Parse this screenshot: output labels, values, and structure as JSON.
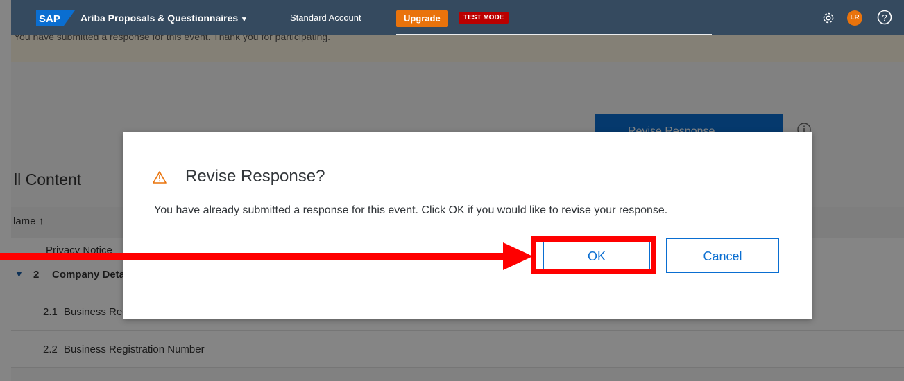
{
  "topbar": {
    "logo": "SAP",
    "product": "Ariba Proposals & Questionnaires",
    "product_caret": "▾",
    "account": "Standard Account",
    "upgrade": "Upgrade",
    "test_mode": "TEST MODE",
    "avatar_initials": "LR"
  },
  "banner": {
    "text": "You have submitted a response for this event.  Thank you for participating."
  },
  "background": {
    "revise_button": "Revise Response",
    "content_title": "ll Content",
    "name_header": "lame ↑",
    "rows": [
      {
        "text": "Privacy Notice"
      },
      {
        "toggle": "▼",
        "num": "2",
        "text": "Company Details"
      },
      {
        "num": "2.1",
        "text": "Business Registration"
      },
      {
        "num": "2.2",
        "text": "Business Registration Number"
      }
    ]
  },
  "dialog": {
    "title": "Revise Response?",
    "message": "You have already submitted a response for this event. Click OK if you would like to revise your response.",
    "ok_label": "OK",
    "cancel_label": "Cancel"
  },
  "colors": {
    "topbar": "#354a5f",
    "upgrade": "#e9730c",
    "test_mode": "#bb0000",
    "primary": "#0a6ed1",
    "warning": "#e9730c",
    "annotation": "#ff0000"
  }
}
